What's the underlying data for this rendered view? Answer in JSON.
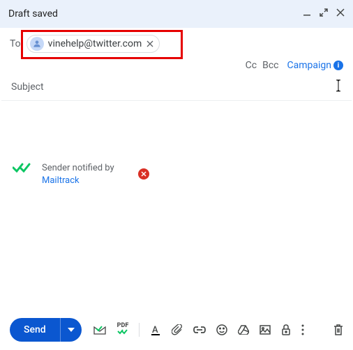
{
  "header": {
    "title": "Draft saved"
  },
  "to": {
    "label": "To",
    "chip_email": "vinehelp@twitter.com"
  },
  "links": {
    "cc": "Cc",
    "bcc": "Bcc",
    "campaign": "Campaign"
  },
  "subject": {
    "placeholder": "Subject",
    "value": ""
  },
  "mailtrack": {
    "text": "Sender notified by",
    "link": "Mailtrack"
  },
  "footer": {
    "send_label": "Send",
    "pdf_label": "PDF"
  }
}
